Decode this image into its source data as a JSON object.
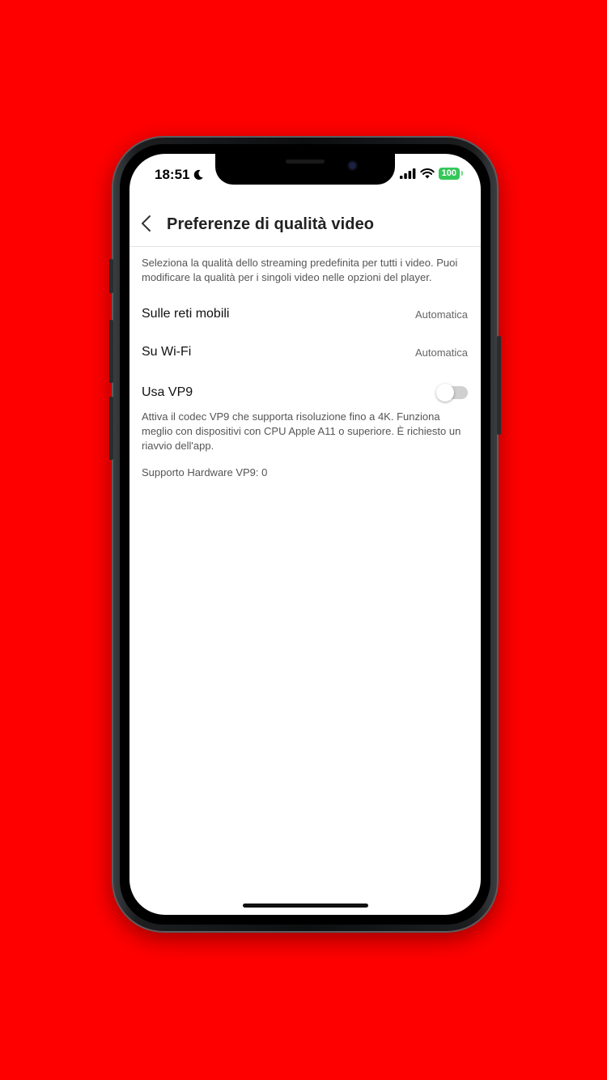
{
  "status_bar": {
    "time": "18:51",
    "battery": "100",
    "colors": {
      "battery": "#34c759"
    }
  },
  "header": {
    "title": "Preferenze di qualità video"
  },
  "intro": {
    "description": "Seleziona la qualità dello streaming predefinita per tutti i video. Puoi modificare la qualità per i singoli video nelle opzioni del player."
  },
  "settings": {
    "mobile": {
      "label": "Sulle reti mobili",
      "value": "Automatica"
    },
    "wifi": {
      "label": "Su Wi-Fi",
      "value": "Automatica"
    },
    "vp9": {
      "label": "Usa VP9",
      "enabled": false,
      "description": "Attiva il codec VP9 che supporta risoluzione fino a 4K. Funziona meglio con dispositivi con CPU Apple A11 o superiore. È richiesto un riavvio dell'app."
    }
  },
  "hardware_support": "Supporto Hardware VP9: 0",
  "colors": {
    "background": "#ff0000"
  }
}
